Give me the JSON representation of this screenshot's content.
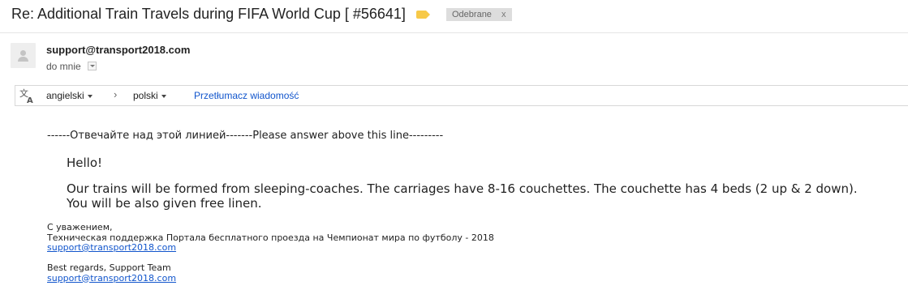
{
  "header": {
    "subject": "Re: Additional Train Travels during FIFA World Cup [ #56641]",
    "label_chip": "Odebrane",
    "label_chip_close": "x"
  },
  "sender": {
    "email": "support@transport2018.com",
    "recipient": "do mnie"
  },
  "translate": {
    "source_language": "angielski",
    "separator": "›",
    "target_language": "polski",
    "translate_link": "Przetłumacz wiadomość"
  },
  "message": {
    "divider": "------Отвечайте над этой линией-------Please answer above this line---------",
    "greeting": "Hello!",
    "body_line1": "Our trains will be formed from sleeping-coaches. The carriages have 8-16 couchettes. The couchette has 4 beds (2 up & 2 down).",
    "body_line2": "You will be also given free linen.",
    "signature_ru": {
      "line1": "С уважением,",
      "line2": "Техническая поддержка Портала бесплатного проезда на Чемпионат мира по футболу - 2018",
      "email": "support@transport2018.com"
    },
    "signature_en": {
      "line1": "Best regards, Support Team",
      "email": "support@transport2018.com"
    }
  },
  "colors": {
    "link": "#1155cc",
    "label_icon": "#f7c948",
    "chip_bg": "#dddddd"
  },
  "icons": {
    "label": "label-tag-icon",
    "avatar": "default-avatar-icon",
    "translate": "translate-icon",
    "dropdown": "chevron-down-icon"
  }
}
